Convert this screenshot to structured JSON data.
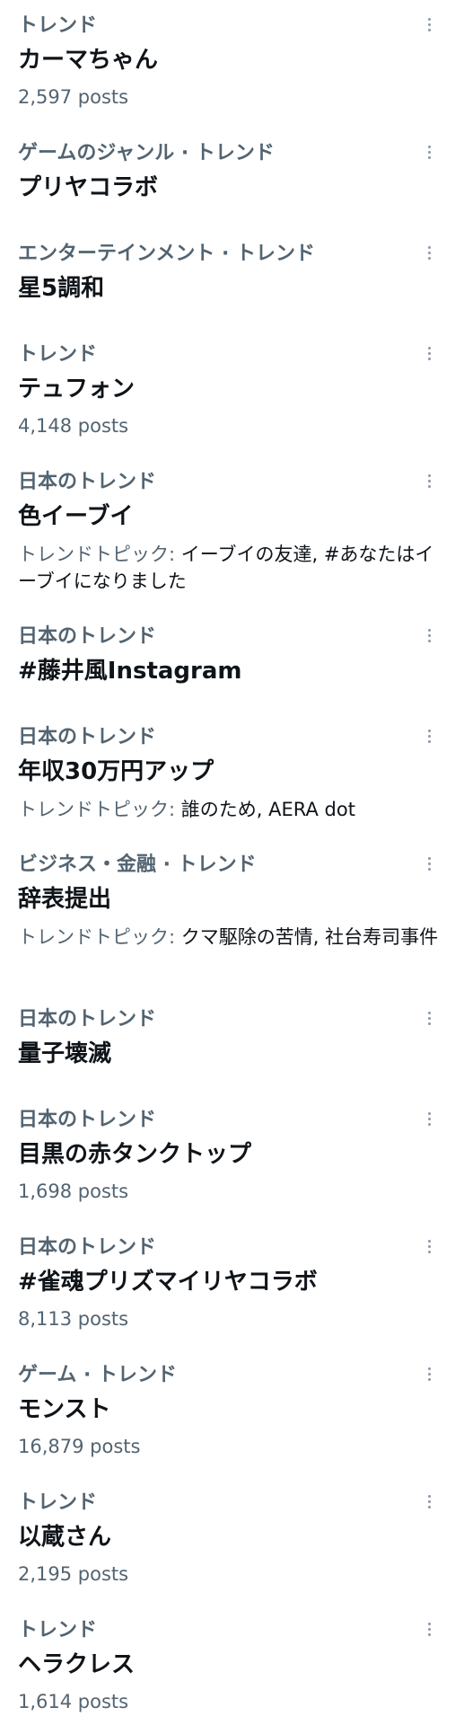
{
  "trends": [
    {
      "category": "トレンド",
      "title": "カーマちゃん",
      "posts": "2,597 posts"
    },
    {
      "category": "ゲームのジャンル · トレンド",
      "title": "プリヤコラボ"
    },
    {
      "category": "エンターテインメント · トレンド",
      "title": "星5調和"
    },
    {
      "category": "トレンド",
      "title": "テュフォン",
      "posts": "4,148 posts"
    },
    {
      "category": "日本のトレンド",
      "title": "色イーブイ",
      "topics_label": "トレンドトピック: ",
      "topics": "イーブイの友達, #あなたはイーブイになりました"
    },
    {
      "category": "日本のトレンド",
      "title": "#藤井風Instagram"
    },
    {
      "category": "日本のトレンド",
      "title": "年収30万円アップ",
      "topics_label": "トレンドトピック: ",
      "topics": "誰のため, AERA dot"
    },
    {
      "category": "ビジネス・金融 · トレンド",
      "title": "辞表提出",
      "topics_label": "トレンドトピック: ",
      "topics": "クマ駆除の苦情, 社台寿司事件"
    },
    {
      "category": "日本のトレンド",
      "title": "量子壊滅"
    },
    {
      "category": "日本のトレンド",
      "title": "目黒の赤タンクトップ",
      "posts": "1,698 posts"
    },
    {
      "category": "日本のトレンド",
      "title": "#雀魂プリズマイリヤコラボ",
      "posts": "8,113 posts"
    },
    {
      "category": "ゲーム · トレンド",
      "title": "モンスト",
      "posts": "16,879 posts"
    },
    {
      "category": "トレンド",
      "title": "以蔵さん",
      "posts": "2,195 posts"
    },
    {
      "category": "トレンド",
      "title": "ヘラクレス",
      "posts": "1,614 posts"
    }
  ],
  "colors": {
    "primary_text": "#0f1419",
    "secondary_text": "#536471",
    "more_icon": "#8b98a5",
    "background": "#ffffff"
  },
  "icons": {
    "more": "more-vertical-icon"
  }
}
